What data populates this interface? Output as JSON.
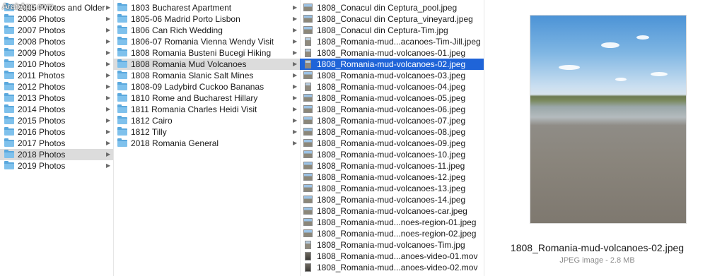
{
  "watermark": "ArabApp.com",
  "column1": {
    "items": [
      {
        "label": "2005 Photos and Older"
      },
      {
        "label": "2006 Photos"
      },
      {
        "label": "2007 Photos"
      },
      {
        "label": "2008 Photos"
      },
      {
        "label": "2009 Photos"
      },
      {
        "label": "2010 Photos"
      },
      {
        "label": "2011 Photos"
      },
      {
        "label": "2012 Photos"
      },
      {
        "label": "2013 Photos"
      },
      {
        "label": "2014 Photos"
      },
      {
        "label": "2015 Photos"
      },
      {
        "label": "2016 Photos"
      },
      {
        "label": "2017 Photos"
      },
      {
        "label": "2018 Photos",
        "selected": true
      },
      {
        "label": "2019 Photos"
      }
    ]
  },
  "column2": {
    "items": [
      {
        "label": "1803 Bucharest Apartment"
      },
      {
        "label": "1805-06 Madrid Porto Lisbon"
      },
      {
        "label": "1806 Can Rich Wedding"
      },
      {
        "label": "1806-07 Romania Vienna Wendy Visit"
      },
      {
        "label": "1808 Romania Busteni Bucegi Hiking"
      },
      {
        "label": "1808 Romania Mud Volcanoes",
        "selected": true
      },
      {
        "label": "1808 Romania Slanic Salt Mines"
      },
      {
        "label": "1808-09 Ladybird Cuckoo Bananas"
      },
      {
        "label": "1810 Rome and Bucharest Hillary"
      },
      {
        "label": "1811 Romania Charles Heidi Visit"
      },
      {
        "label": "1812 Cairo"
      },
      {
        "label": "1812 Tilly"
      },
      {
        "label": "2018 Romania General"
      }
    ]
  },
  "column3": {
    "items": [
      {
        "label": "1808_Conacul din Ceptura_pool.jpeg",
        "kind": "image"
      },
      {
        "label": "1808_Conacul din Ceptura_vineyard.jpeg",
        "kind": "image"
      },
      {
        "label": "1808_Conacul din Ceptura-Tim.jpg",
        "kind": "image"
      },
      {
        "label": "1808_Romania-mud...acanoes-Tim-Jill.jpeg",
        "kind": "portrait"
      },
      {
        "label": "1808_Romania-mud-volcanoes-01.jpeg",
        "kind": "portrait"
      },
      {
        "label": "1808_Romania-mud-volcanoes-02.jpeg",
        "kind": "portrait",
        "selected": true
      },
      {
        "label": "1808_Romania-mud-volcanoes-03.jpeg",
        "kind": "image"
      },
      {
        "label": "1808_Romania-mud-volcanoes-04.jpeg",
        "kind": "portrait"
      },
      {
        "label": "1808_Romania-mud-volcanoes-05.jpeg",
        "kind": "image"
      },
      {
        "label": "1808_Romania-mud-volcanoes-06.jpeg",
        "kind": "image"
      },
      {
        "label": "1808_Romania-mud-volcanoes-07.jpeg",
        "kind": "image"
      },
      {
        "label": "1808_Romania-mud-volcanoes-08.jpeg",
        "kind": "image"
      },
      {
        "label": "1808_Romania-mud-volcanoes-09.jpeg",
        "kind": "image"
      },
      {
        "label": "1808_Romania-mud-volcanoes-10.jpeg",
        "kind": "image"
      },
      {
        "label": "1808_Romania-mud-volcanoes-11.jpeg",
        "kind": "image"
      },
      {
        "label": "1808_Romania-mud-volcanoes-12.jpeg",
        "kind": "image"
      },
      {
        "label": "1808_Romania-mud-volcanoes-13.jpeg",
        "kind": "image"
      },
      {
        "label": "1808_Romania-mud-volcanoes-14.jpeg",
        "kind": "image"
      },
      {
        "label": "1808_Romania-mud-volcanoes-car.jpeg",
        "kind": "image"
      },
      {
        "label": "1808_Romania-mud...noes-region-01.jpeg",
        "kind": "image"
      },
      {
        "label": "1808_Romania-mud...noes-region-02.jpeg",
        "kind": "image"
      },
      {
        "label": "1808_Romania-mud-volcanoes-Tim.jpg",
        "kind": "portrait"
      },
      {
        "label": "1808_Romania-mud...anoes-video-01.mov",
        "kind": "movie"
      },
      {
        "label": "1808_Romania-mud...anoes-video-02.mov",
        "kind": "movie"
      }
    ]
  },
  "preview": {
    "filename": "1808_Romania-mud-volcanoes-02.jpeg",
    "info": "JPEG image - 2.8 MB"
  },
  "icons": {
    "folder": "folder-icon",
    "chevron": "chevron-right-icon",
    "image": "image-thumbnail-icon",
    "movie": "movie-thumbnail-icon"
  },
  "colors": {
    "selection_blue": "#1f64d8",
    "selection_grey": "#dcdcdc",
    "folder_blue": "#7fc1ec"
  }
}
